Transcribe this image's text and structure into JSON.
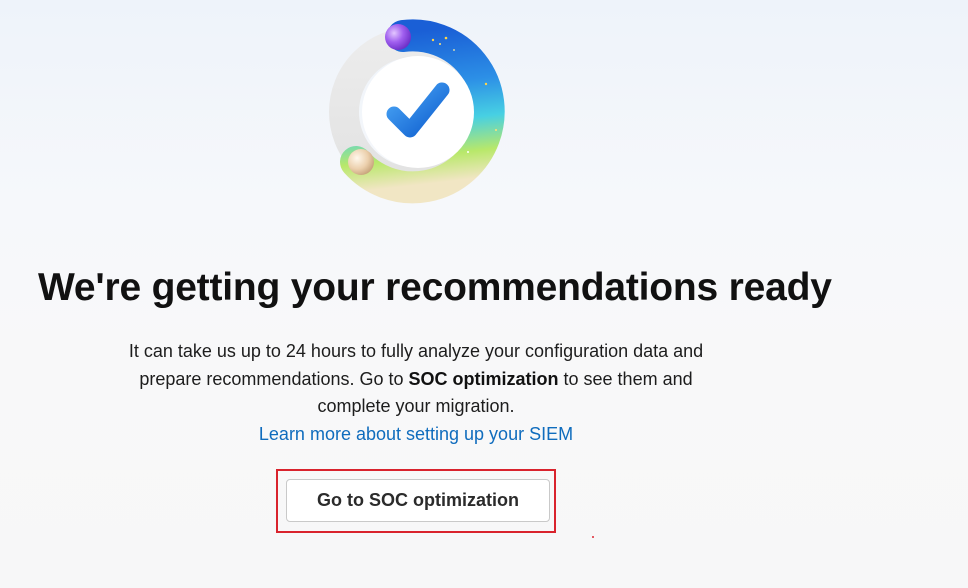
{
  "hero": {
    "icon": "checkmark-progress-ring-icon"
  },
  "headline": "We're getting your recommendations ready",
  "description": {
    "part1": "It can take us up to 24 hours to fully analyze your configuration data and prepare recommendations. Go to ",
    "bold": "SOC optimization",
    "part2": " to see them and complete your migration.",
    "link": "Learn more about setting up your SIEM"
  },
  "cta": {
    "label": "Go to SOC optimization"
  },
  "colors": {
    "link": "#0f6cbd",
    "highlight": "#d9232d",
    "check": "#1f7ee0"
  }
}
